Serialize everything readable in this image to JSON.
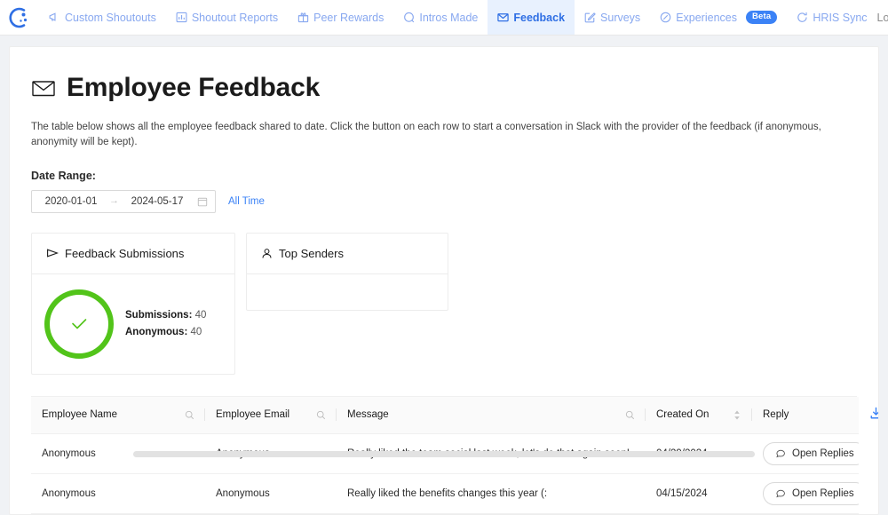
{
  "nav": {
    "logo_icon": "app-logo-smiley",
    "items": [
      {
        "label": "Custom Shoutouts",
        "icon": "megaphone-icon",
        "active": false
      },
      {
        "label": "Shoutout Reports",
        "icon": "bar-chart-icon",
        "active": false
      },
      {
        "label": "Peer Rewards",
        "icon": "gift-icon",
        "active": false
      },
      {
        "label": "Intros Made",
        "icon": "speech-bubble-icon",
        "active": false
      },
      {
        "label": "Feedback",
        "icon": "envelope-icon",
        "active": true
      },
      {
        "label": "Surveys",
        "icon": "edit-square-icon",
        "active": false
      },
      {
        "label": "Experiences",
        "icon": "compass-icon",
        "active": false,
        "badge": "Beta"
      },
      {
        "label": "HRIS Sync",
        "icon": "refresh-icon",
        "active": false
      }
    ],
    "logout_label": "Logout",
    "active_color": "#2f6fe4",
    "link_color": "#88a8f0",
    "badge_color": "#3b82f6"
  },
  "page": {
    "title": "Employee Feedback",
    "title_icon": "envelope-icon",
    "description": "The table below shows all the employee feedback shared to date. Click the button on each row to start a conversation in Slack with the provider of the feedback (if anonymous, anonymity will be kept).",
    "date_range_label": "Date Range:"
  },
  "date_picker": {
    "start": "2020-01-01",
    "end": "2024-05-17",
    "separator": "→",
    "calendar_icon": "calendar-icon",
    "all_time_label": "All Time",
    "all_time_color": "#3b82f6"
  },
  "cards": [
    {
      "title": "Feedback Submissions",
      "icon": "send-triangle-icon",
      "ring_color": "#52c41a",
      "status_icon": "check-icon",
      "stats": [
        {
          "label": "Submissions:",
          "value": "40"
        },
        {
          "label": "Anonymous:",
          "value": "40"
        }
      ]
    },
    {
      "title": "Top Senders",
      "icon": "user-icon",
      "empty": true
    }
  ],
  "table": {
    "columns": [
      {
        "label": "Employee Name",
        "icon": "search-icon"
      },
      {
        "label": "Employee Email",
        "icon": "search-icon"
      },
      {
        "label": "Message",
        "icon": "search-icon"
      },
      {
        "label": "Created On",
        "icon": "sort-icon"
      },
      {
        "label": "Reply",
        "icon": ""
      }
    ],
    "download_icon": "download-icon",
    "download_color": "#3b82f6",
    "rows": [
      {
        "name": "Anonymous",
        "email": "Anonymous",
        "message": "Really liked the team social last week, let's do that again soon!",
        "created_on": "04/29/2024",
        "reply_label": "Open Replies",
        "reply_icon": "chat-icon"
      },
      {
        "name": "Anonymous",
        "email": "Anonymous",
        "message": "Really liked the benefits changes this year (:",
        "created_on": "04/15/2024",
        "reply_label": "Open Replies",
        "reply_icon": "chat-icon"
      }
    ]
  }
}
